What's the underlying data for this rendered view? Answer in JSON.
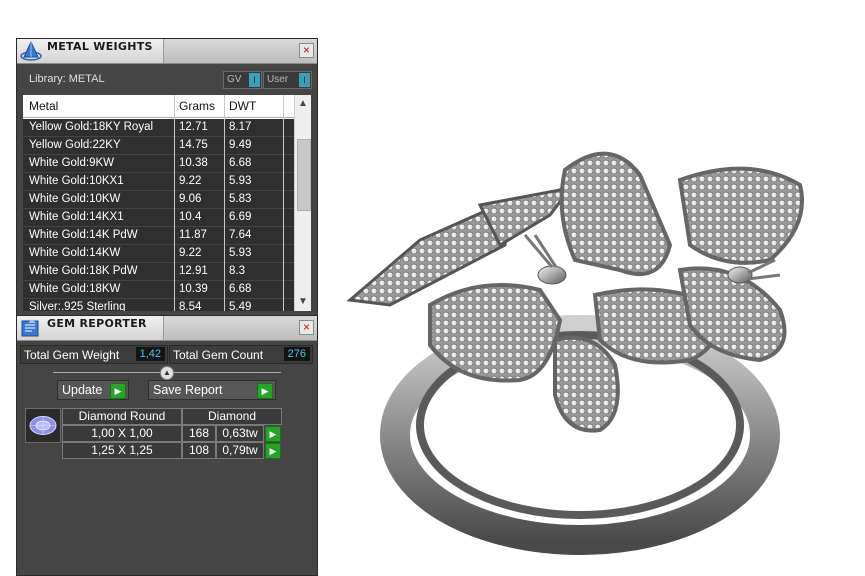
{
  "metal_weights": {
    "title": "METAL WEIGHTS",
    "library_label": "Library: METAL",
    "toggle_gv": "GV",
    "toggle_user": "User",
    "toggle_indicator": "I",
    "columns": [
      "Metal",
      "Grams",
      "DWT"
    ],
    "rows": [
      {
        "metal": "Yellow Gold:18KY Royal",
        "grams": "12.71",
        "dwt": "8.17"
      },
      {
        "metal": "Yellow Gold:22KY",
        "grams": "14.75",
        "dwt": "9.49"
      },
      {
        "metal": "White Gold:9KW",
        "grams": "10.38",
        "dwt": "6.68"
      },
      {
        "metal": "White Gold:10KX1",
        "grams": "9.22",
        "dwt": "5.93"
      },
      {
        "metal": "White Gold:10KW",
        "grams": "9.06",
        "dwt": "5.83"
      },
      {
        "metal": "White Gold:14KX1",
        "grams": "10.4",
        "dwt": "6.69"
      },
      {
        "metal": "White Gold:14K PdW",
        "grams": "11.87",
        "dwt": "7.64"
      },
      {
        "metal": "White Gold:14KW",
        "grams": "9.22",
        "dwt": "5.93"
      },
      {
        "metal": "White Gold:18K PdW",
        "grams": "12.91",
        "dwt": "8.3"
      },
      {
        "metal": "White Gold:18KW",
        "grams": "10.39",
        "dwt": "6.68"
      },
      {
        "metal": "Silver:.925 Sterling",
        "grams": "8.54",
        "dwt": "5.49"
      }
    ]
  },
  "gem_reporter": {
    "title": "GEM REPORTER",
    "total_weight_label": "Total Gem Weight",
    "total_weight_value": "1,42",
    "total_count_label": "Total Gem Count",
    "total_count_value": "276",
    "update_label": "Update",
    "save_label": "Save Report",
    "gem_shape": "Diamond Round",
    "gem_material": "Diamond",
    "gems": [
      {
        "size": "1,00 X 1,00",
        "count": "168",
        "weight": "0,63tw"
      },
      {
        "size": "1,25 X 1,25",
        "count": "108",
        "weight": "0,79tw"
      }
    ]
  },
  "icons": {
    "close": "close-icon",
    "play": "play-icon",
    "gem": "round-diamond-icon",
    "app": "pyramid-app-icon"
  },
  "colors": {
    "panel_bg": "#454545",
    "value_text": "#4fc3ea",
    "play_button": "#27a327",
    "close_x": "#c01010"
  }
}
